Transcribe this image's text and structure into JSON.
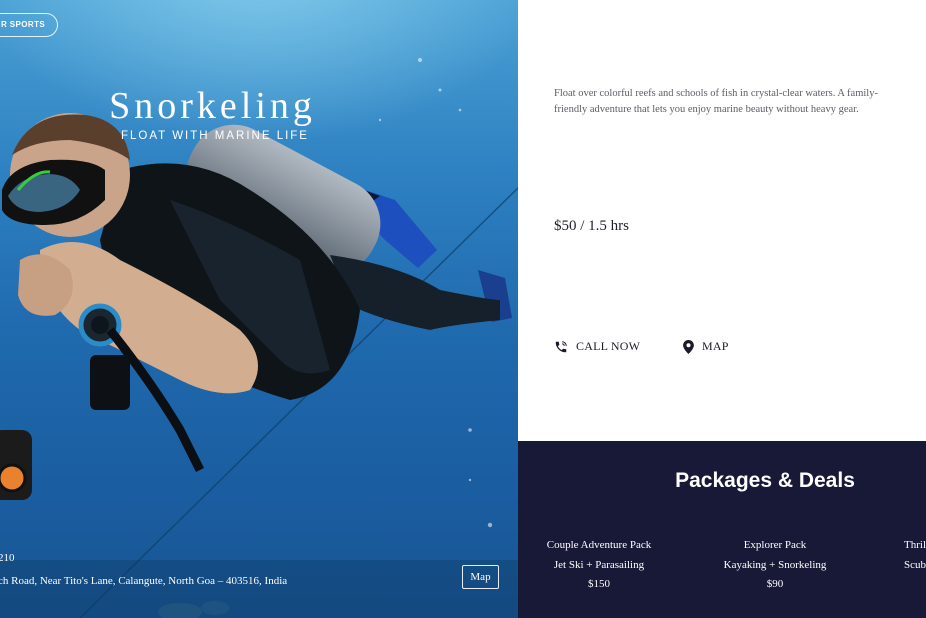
{
  "hero": {
    "pill_label": "R SPORTS",
    "title": "Snorkeling",
    "subtitle": "FLOAT WITH MARINE LIFE",
    "phone": "210",
    "address": "ch Road, Near Tito's Lane, Calangute, North Goa – 403516, India",
    "map_button": "Map"
  },
  "info": {
    "description": "Float over colorful reefs and schools of fish in crystal-clear waters. A family-friendly adventure that lets you enjoy marine beauty without heavy gear.",
    "price": "$50 / 1.5 hrs",
    "call_label": "CALL NOW",
    "map_label": "MAP",
    "call_icon": "phone-ringing-icon",
    "map_icon": "map-pin-icon"
  },
  "packages": {
    "title": "Packages & Deals",
    "items": [
      {
        "name": "Couple Adventure Pack",
        "details": "Jet Ski + Parasailing",
        "price": "$150"
      },
      {
        "name": "Explorer Pack",
        "details": "Kayaking + Snorkeling",
        "price": "$90"
      },
      {
        "name": "Thrill",
        "details": "Scub",
        "price": ""
      }
    ]
  },
  "colors": {
    "packages_bg": "#181936",
    "water": "#2c7fc0",
    "text_dark": "#1b1b28",
    "text_muted": "#5d5d66"
  }
}
